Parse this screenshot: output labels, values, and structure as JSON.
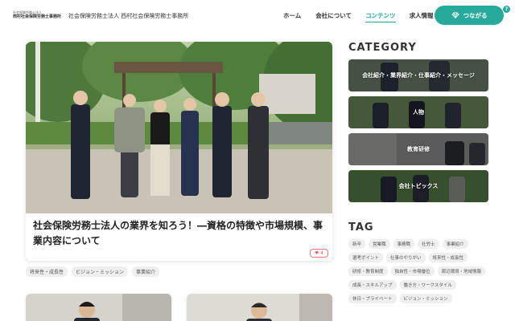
{
  "header": {
    "logo_small": "社会保険労務士法人",
    "logo_big": "西村社会保険労務士事務所",
    "company": "社会保険労務士法人 西村社会保険労務士事務所",
    "nav": [
      {
        "label": "ホーム",
        "active": false
      },
      {
        "label": "会社について",
        "active": false
      },
      {
        "label": "コンテンツ",
        "active": true
      },
      {
        "label": "求人情報",
        "active": false
      }
    ],
    "cta_label": "つながる",
    "help_badge": "?"
  },
  "feature": {
    "title": "社会保険労務士法人の業界を知ろう！―資格の特徴や市場規模、事業内容について",
    "likes": "4",
    "tags": [
      "将来性・成長性",
      "ビジョン・ミッション",
      "事業紹介"
    ]
  },
  "sidebar": {
    "category_heading": "CATEGORY",
    "categories": [
      "会社紹介・業界紹介・仕事紹介・メッセージ",
      "人物",
      "教育研修",
      "会社トピックス"
    ],
    "tag_heading": "TAG",
    "tags": [
      "新卒",
      "営業職",
      "事務職",
      "社労士",
      "事業紹介",
      "選考ポイント",
      "仕事のやりがい",
      "将来性・成長性",
      "研修・教育制度",
      "独自性・市場優位",
      "周辺環境・地域情報",
      "成長・スキルアップ",
      "働き方・ワークスタイル",
      "休日・プライベート",
      "ビジョン・ミッション"
    ]
  },
  "colors": {
    "accent": "#27aa9c",
    "like": "#dd5555"
  },
  "icons": {
    "cta": "diamond-icon",
    "like": "heart-icon"
  }
}
